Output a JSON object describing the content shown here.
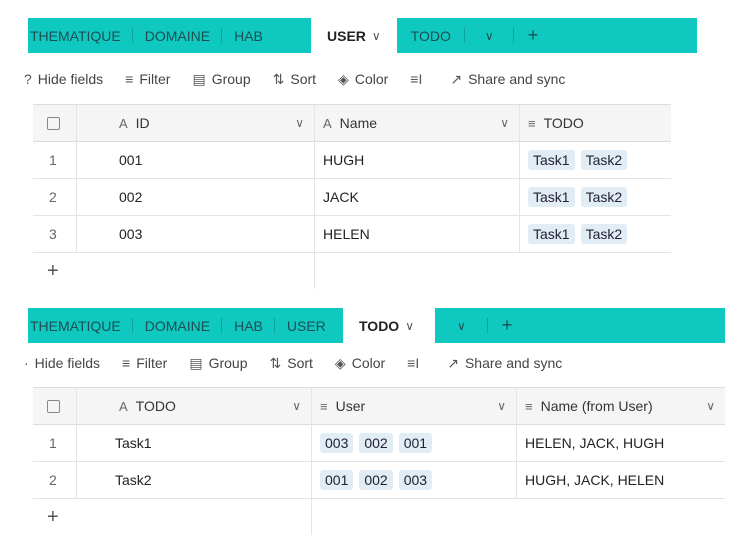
{
  "top": {
    "tabs": [
      "THEMATIQUE",
      "DOMAINE",
      "HAB"
    ],
    "active_tab": "USER",
    "after_tabs": [
      "TODO"
    ],
    "toolbar": {
      "hide_fields": "Hide fields",
      "filter": "Filter",
      "group": "Group",
      "sort": "Sort",
      "color": "Color",
      "share": "Share and sync"
    },
    "columns": {
      "id": "ID",
      "name": "Name",
      "todo": "TODO"
    },
    "rows": [
      {
        "n": "1",
        "id": "001",
        "name": "HUGH",
        "todo": [
          "Task1",
          "Task2"
        ]
      },
      {
        "n": "2",
        "id": "002",
        "name": "JACK",
        "todo": [
          "Task1",
          "Task2"
        ]
      },
      {
        "n": "3",
        "id": "003",
        "name": "HELEN",
        "todo": [
          "Task1",
          "Task2"
        ]
      }
    ]
  },
  "bottom": {
    "tabs": [
      "THEMATIQUE",
      "DOMAINE",
      "HAB",
      "USER"
    ],
    "active_tab": "TODO",
    "toolbar": {
      "hide_fields": "Hide fields",
      "filter": "Filter",
      "group": "Group",
      "sort": "Sort",
      "color": "Color",
      "share": "Share and sync"
    },
    "columns": {
      "todo": "TODO",
      "user": "User",
      "name_from_user": "Name (from User)"
    },
    "rows": [
      {
        "n": "1",
        "todo": "Task1",
        "user": [
          "003",
          "002",
          "001"
        ],
        "names": "HELEN, JACK, HUGH"
      },
      {
        "n": "2",
        "todo": "Task2",
        "user": [
          "001",
          "002",
          "003"
        ],
        "names": "HUGH, JACK, HELEN"
      }
    ]
  },
  "colors": {
    "tab_accent": "#0fc8c0",
    "chip": "#e2ecf5"
  }
}
